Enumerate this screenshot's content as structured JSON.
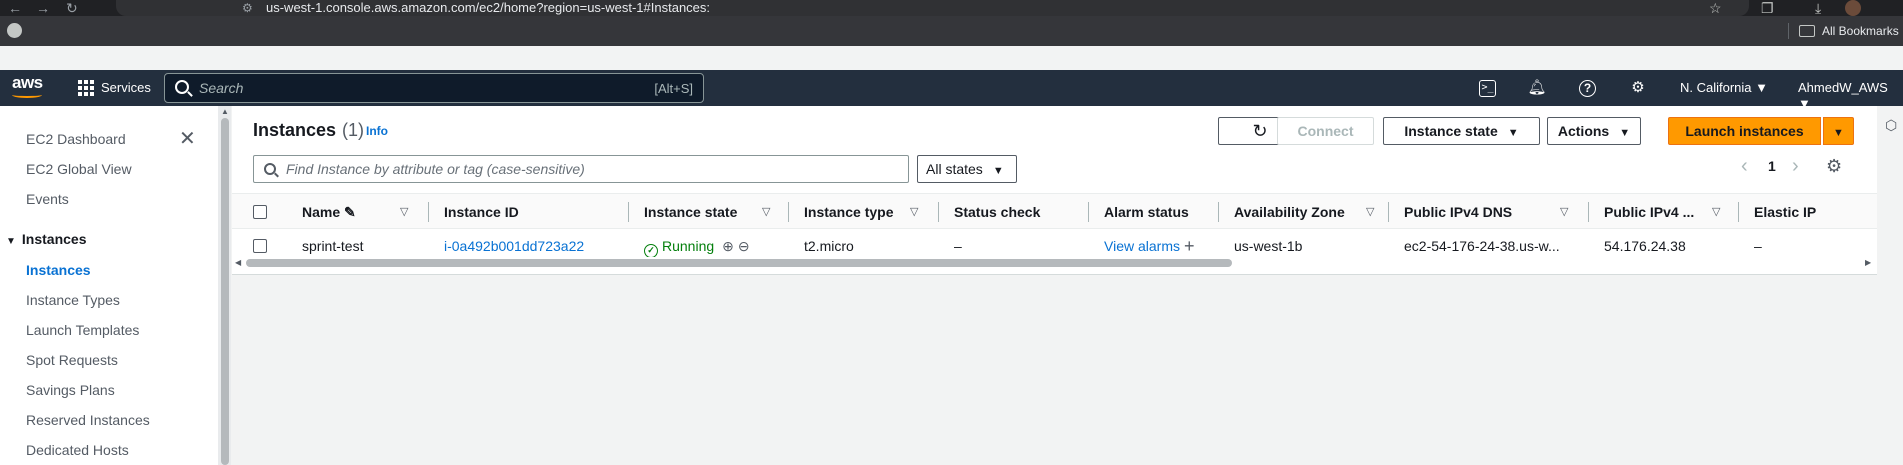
{
  "browser": {
    "back": "←",
    "forward": "→",
    "reload": "↻",
    "url": "us-west-1.console.aws.amazon.com/ec2/home?region=us-west-1#Instances:",
    "bookmarks_label": "All Bookmarks"
  },
  "topnav": {
    "logo": "aws",
    "services_label": "Services",
    "search_placeholder": "Search",
    "search_shortcut": "[Alt+S]",
    "region": "N. California ▼",
    "account": "AhmedW_AWS ▼"
  },
  "sidebar": {
    "items_top": [
      "EC2 Dashboard",
      "EC2 Global View",
      "Events"
    ],
    "section_label": "Instances",
    "items": [
      "Instances",
      "Instance Types",
      "Launch Templates",
      "Spot Requests",
      "Savings Plans",
      "Reserved Instances",
      "Dedicated Hosts"
    ]
  },
  "panel": {
    "title": "Instances",
    "count": "(1)",
    "info": "Info",
    "connect_label": "Connect",
    "instance_state_label": "Instance state",
    "actions_label": "Actions",
    "launch_label": "Launch instances",
    "filter_placeholder": "Find Instance by attribute or tag (case-sensitive)",
    "states_label": "All states",
    "page_number": "1"
  },
  "table": {
    "columns": [
      "Name",
      "Instance ID",
      "Instance state",
      "Instance type",
      "Status check",
      "Alarm status",
      "Availability Zone",
      "Public IPv4 DNS",
      "Public IPv4 ...",
      "Elastic IP"
    ],
    "rows": [
      {
        "name": "sprint-test",
        "instance_id": "i-0a492b001dd723a22",
        "state": "Running",
        "type": "t2.micro",
        "status_check": "–",
        "alarm_status": "View alarms",
        "az": "us-west-1b",
        "dns": "ec2-54-176-24-38.us-w...",
        "ipv4": "54.176.24.38",
        "elastic_ip": "–"
      }
    ]
  },
  "colors": {
    "aws_nav": "#232f3e",
    "link": "#0972d3",
    "primary_button": "#ff9900",
    "running": "#037f0c"
  }
}
